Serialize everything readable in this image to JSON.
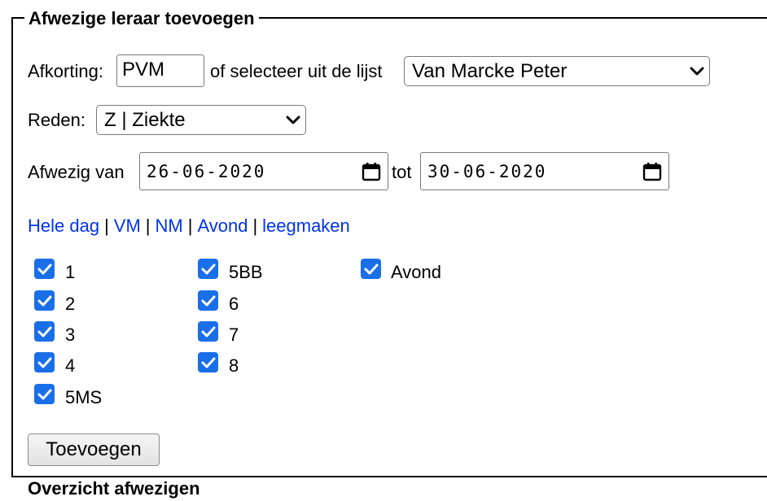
{
  "form": {
    "legend": "Afwezige leraar toevoegen",
    "abbrev_label": "Afkorting:",
    "abbrev_value": "PVM",
    "select_from_list_label": "of selecteer uit de lijst",
    "teacher_selected": "Van Marcke Peter",
    "reason_label": "Reden:",
    "reason_selected": "Z | Ziekte",
    "absent_from_label": "Afwezig van",
    "date_from": "26-06-2020",
    "to_label": "tot",
    "date_to": "30-06-2020",
    "quick_links": [
      "Hele dag",
      "VM",
      "NM",
      "Avond",
      "leegmaken"
    ],
    "link_separator": "|",
    "periods": [
      {
        "label": "1",
        "checked": true
      },
      {
        "label": "2",
        "checked": true
      },
      {
        "label": "3",
        "checked": true
      },
      {
        "label": "4",
        "checked": true
      },
      {
        "label": "5MS",
        "checked": true
      },
      {
        "label": "5BB",
        "checked": true
      },
      {
        "label": "6",
        "checked": true
      },
      {
        "label": "7",
        "checked": true
      },
      {
        "label": "8",
        "checked": true
      },
      {
        "label": "Avond",
        "checked": true
      }
    ],
    "submit_label": "Toevoegen"
  },
  "next_section_title": "Overzicht afwezigen",
  "icons": {
    "dropdown": "chevron-down-icon",
    "date_picker": "calendar-icon",
    "checkbox": "checkmark-icon"
  },
  "colors": {
    "link": "#0033ee",
    "checkbox_fill": "#1a6fe8"
  }
}
